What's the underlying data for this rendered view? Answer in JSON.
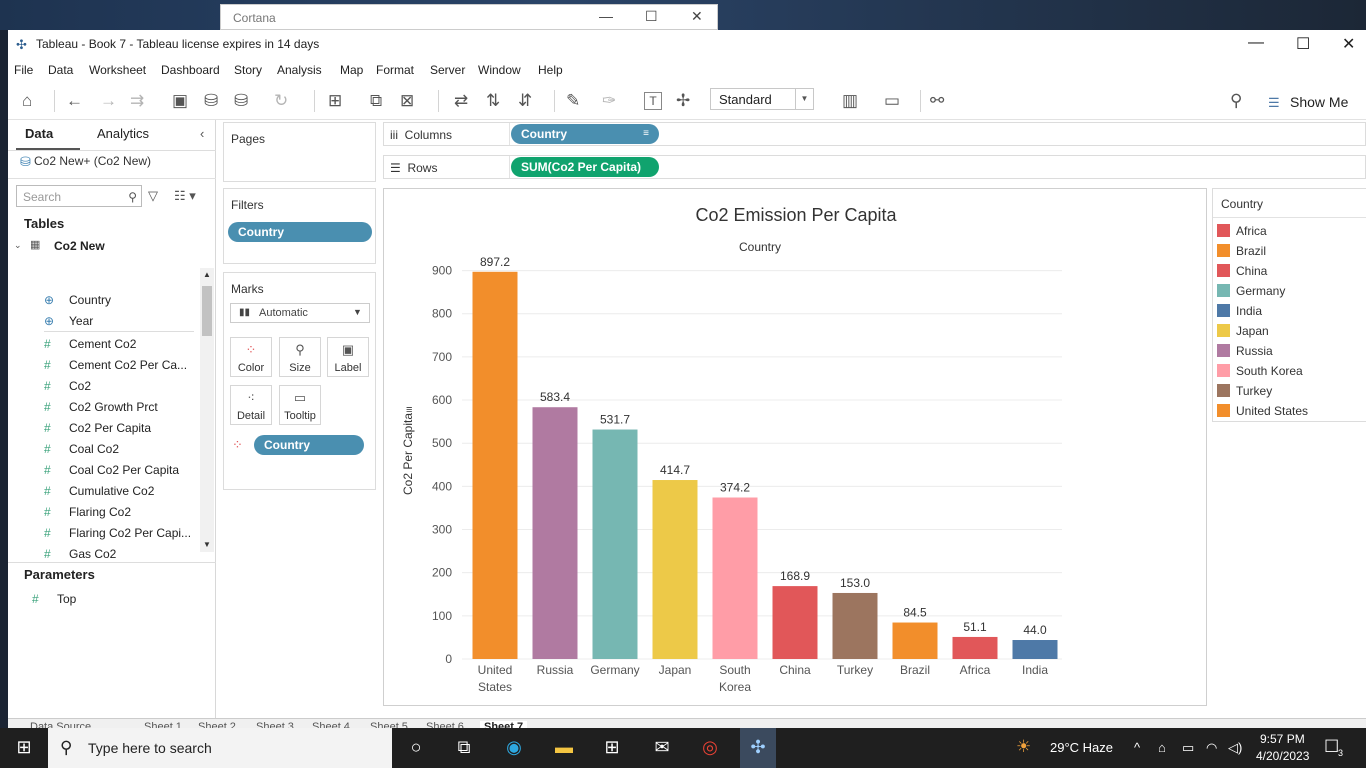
{
  "cortana": {
    "title": "Cortana"
  },
  "window": {
    "title": "Tableau - Book 7 - Tableau license expires in 14 days"
  },
  "menu": [
    "File",
    "Data",
    "Worksheet",
    "Dashboard",
    "Story",
    "Analysis",
    "Map",
    "Format",
    "Server",
    "Window",
    "Help"
  ],
  "toolbar": {
    "fit_value": "Standard",
    "show_me": "Show Me"
  },
  "data_pane": {
    "tab_data": "Data",
    "tab_analytics": "Analytics",
    "datasource": "Co2 New+ (Co2 New)",
    "search_placeholder": "Search",
    "tables_header": "Tables",
    "table_name": "Co2 New",
    "fields": [
      "Country",
      "Year",
      "Cement Co2",
      "Cement Co2 Per Ca...",
      "Co2",
      "Co2 Growth Prct",
      "Co2 Per Capita",
      "Coal Co2",
      "Coal Co2 Per Capita",
      "Cumulative Co2",
      "Flaring Co2",
      "Flaring Co2 Per Capi...",
      "Gas Co2"
    ],
    "parameters_header": "Parameters",
    "parameters": [
      "Top"
    ]
  },
  "shelves": {
    "pages": "Pages",
    "filters": "Filters",
    "filter_pill": "Country",
    "marks": "Marks",
    "mark_type": "Automatic",
    "mark_buttons": [
      "Color",
      "Size",
      "Label",
      "Detail",
      "Tooltip"
    ],
    "color_pill": "Country",
    "columns_label": "Columns",
    "columns_pill": "Country",
    "rows_label": "Rows",
    "rows_pill": "SUM(Co2 Per Capita)"
  },
  "legend": {
    "title": "Country",
    "items": [
      {
        "label": "Africa",
        "color": "#e15759"
      },
      {
        "label": "Brazil",
        "color": "#f28e2b"
      },
      {
        "label": "China",
        "color": "#e15759"
      },
      {
        "label": "Germany",
        "color": "#76b7b2"
      },
      {
        "label": "India",
        "color": "#4e79a7"
      },
      {
        "label": "Japan",
        "color": "#edc948"
      },
      {
        "label": "Russia",
        "color": "#b07aa1"
      },
      {
        "label": "South Korea",
        "color": "#ff9da7"
      },
      {
        "label": "Turkey",
        "color": "#9c755f"
      },
      {
        "label": "United States",
        "color": "#f28e2b"
      }
    ]
  },
  "chart_data": {
    "type": "bar",
    "title": "Co2 Emission Per Capita",
    "subtitle": "Country",
    "ylabel": "Co2 Per Capita",
    "xlabel": "",
    "ylim": [
      0,
      950
    ],
    "yticks": [
      0,
      100,
      200,
      300,
      400,
      500,
      600,
      700,
      800,
      900
    ],
    "grid": true,
    "categories": [
      "United States",
      "Russia",
      "Germany",
      "Japan",
      "South Korea",
      "China",
      "Turkey",
      "Brazil",
      "Africa",
      "India"
    ],
    "category_lines": [
      [
        "United",
        "States"
      ],
      [
        "Russia"
      ],
      [
        "Germany"
      ],
      [
        "Japan"
      ],
      [
        "South",
        "Korea"
      ],
      [
        "China"
      ],
      [
        "Turkey"
      ],
      [
        "Brazil"
      ],
      [
        "Africa"
      ],
      [
        "India"
      ]
    ],
    "values": [
      897.2,
      583.4,
      531.7,
      414.7,
      374.2,
      168.9,
      153.0,
      84.5,
      51.1,
      44.0
    ],
    "value_labels": [
      "897.2",
      "583.4",
      "531.7",
      "414.7",
      "374.2",
      "168.9",
      "153.0",
      "84.5",
      "51.1",
      "44.0"
    ],
    "colors": [
      "#f28e2b",
      "#b07aa1",
      "#76b7b2",
      "#edc948",
      "#ff9da7",
      "#e15759",
      "#9c755f",
      "#f28e2b",
      "#e15759",
      "#4e79a7"
    ]
  },
  "sheet_tabs": [
    "Data Source",
    "Sheet 1",
    "Sheet 2",
    "Sheet 3",
    "Sheet 4",
    "Sheet 5",
    "Sheet 6",
    "Sheet 7"
  ],
  "taskbar": {
    "search_placeholder": "Type here to search",
    "weather": "29°C  Haze",
    "time": "9:57 PM",
    "date": "4/20/2023",
    "notifications": "3"
  }
}
